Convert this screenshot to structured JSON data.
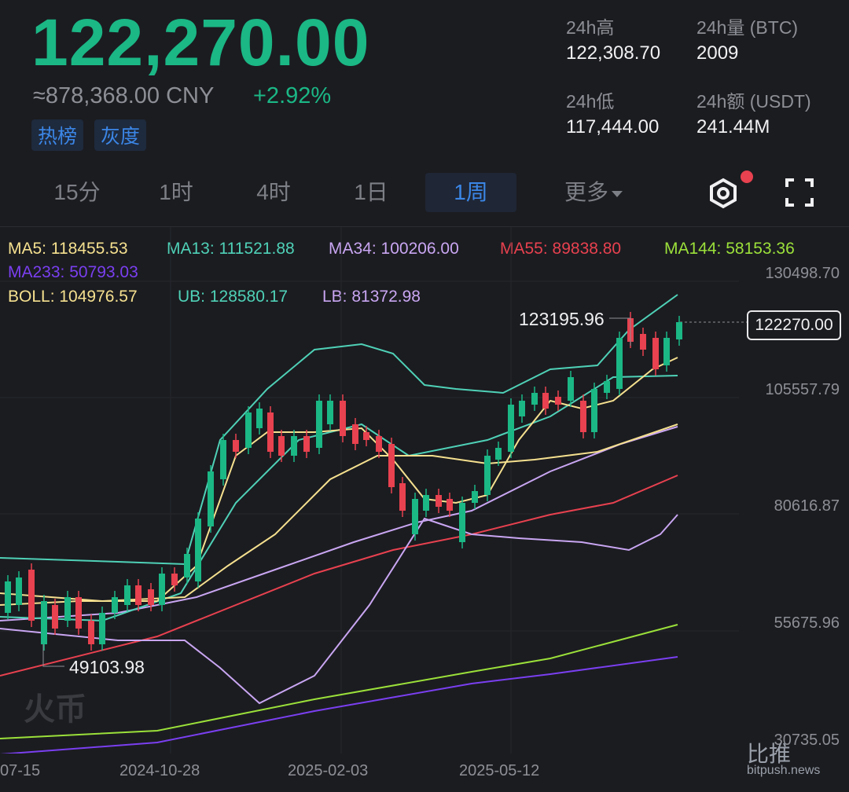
{
  "header": {
    "price": "122,270.00",
    "cny": "≈878,368.00 CNY",
    "change": "+2.92%",
    "tags": [
      "热榜",
      "灰度"
    ]
  },
  "stats": {
    "high_label": "24h高",
    "high_value": "122,308.70",
    "vol_label": "24h量 (BTC)",
    "vol_value": "2009",
    "low_label": "24h低",
    "low_value": "117,444.00",
    "amt_label": "24h额 (USDT)",
    "amt_value": "241.44M"
  },
  "tabs": {
    "t15m": "15分",
    "t1h": "1时",
    "t4h": "4时",
    "t1d": "1日",
    "t1w": "1周",
    "more": "更多"
  },
  "indicators": {
    "ma5": "MA5: 118455.53",
    "ma13": "MA13: 111521.88",
    "ma34": "MA34: 100206.00",
    "ma55": "MA55: 89838.80",
    "ma144": "MA144: 58153.36",
    "ma233": "MA233: 50793.03",
    "boll": "BOLL: 104976.57",
    "ub": "UB: 128580.17",
    "lb": "LB: 81372.98"
  },
  "colors": {
    "up": "#1bb785",
    "down": "#e8414f",
    "ma5": "#f5e08f",
    "ma13": "#4fd1b7",
    "ma34": "#c9a6f2",
    "ma55": "#e8414f",
    "ma144": "#9be03a",
    "ma233": "#7a3ff0"
  },
  "icons": {
    "settings": "settings-hex-icon",
    "fullscreen": "fullscreen-icon",
    "dot": "notification-dot-icon"
  },
  "chart_data": {
    "type": "candlestick",
    "y_axis_labels": [
      "130498.70",
      "105557.79",
      "80616.87",
      "55675.96",
      "30735.05"
    ],
    "x_axis_labels": [
      "07-15",
      "2024-10-28",
      "2025-02-03",
      "2025-05-12"
    ],
    "current_price_tag": "122270.00",
    "high_marker": "123195.96",
    "low_marker": "49103.98",
    "ylim": [
      30735.05,
      130498.7
    ]
  },
  "watermarks": {
    "left": "火币",
    "right": "比推",
    "right_url": "bitpush.news"
  }
}
